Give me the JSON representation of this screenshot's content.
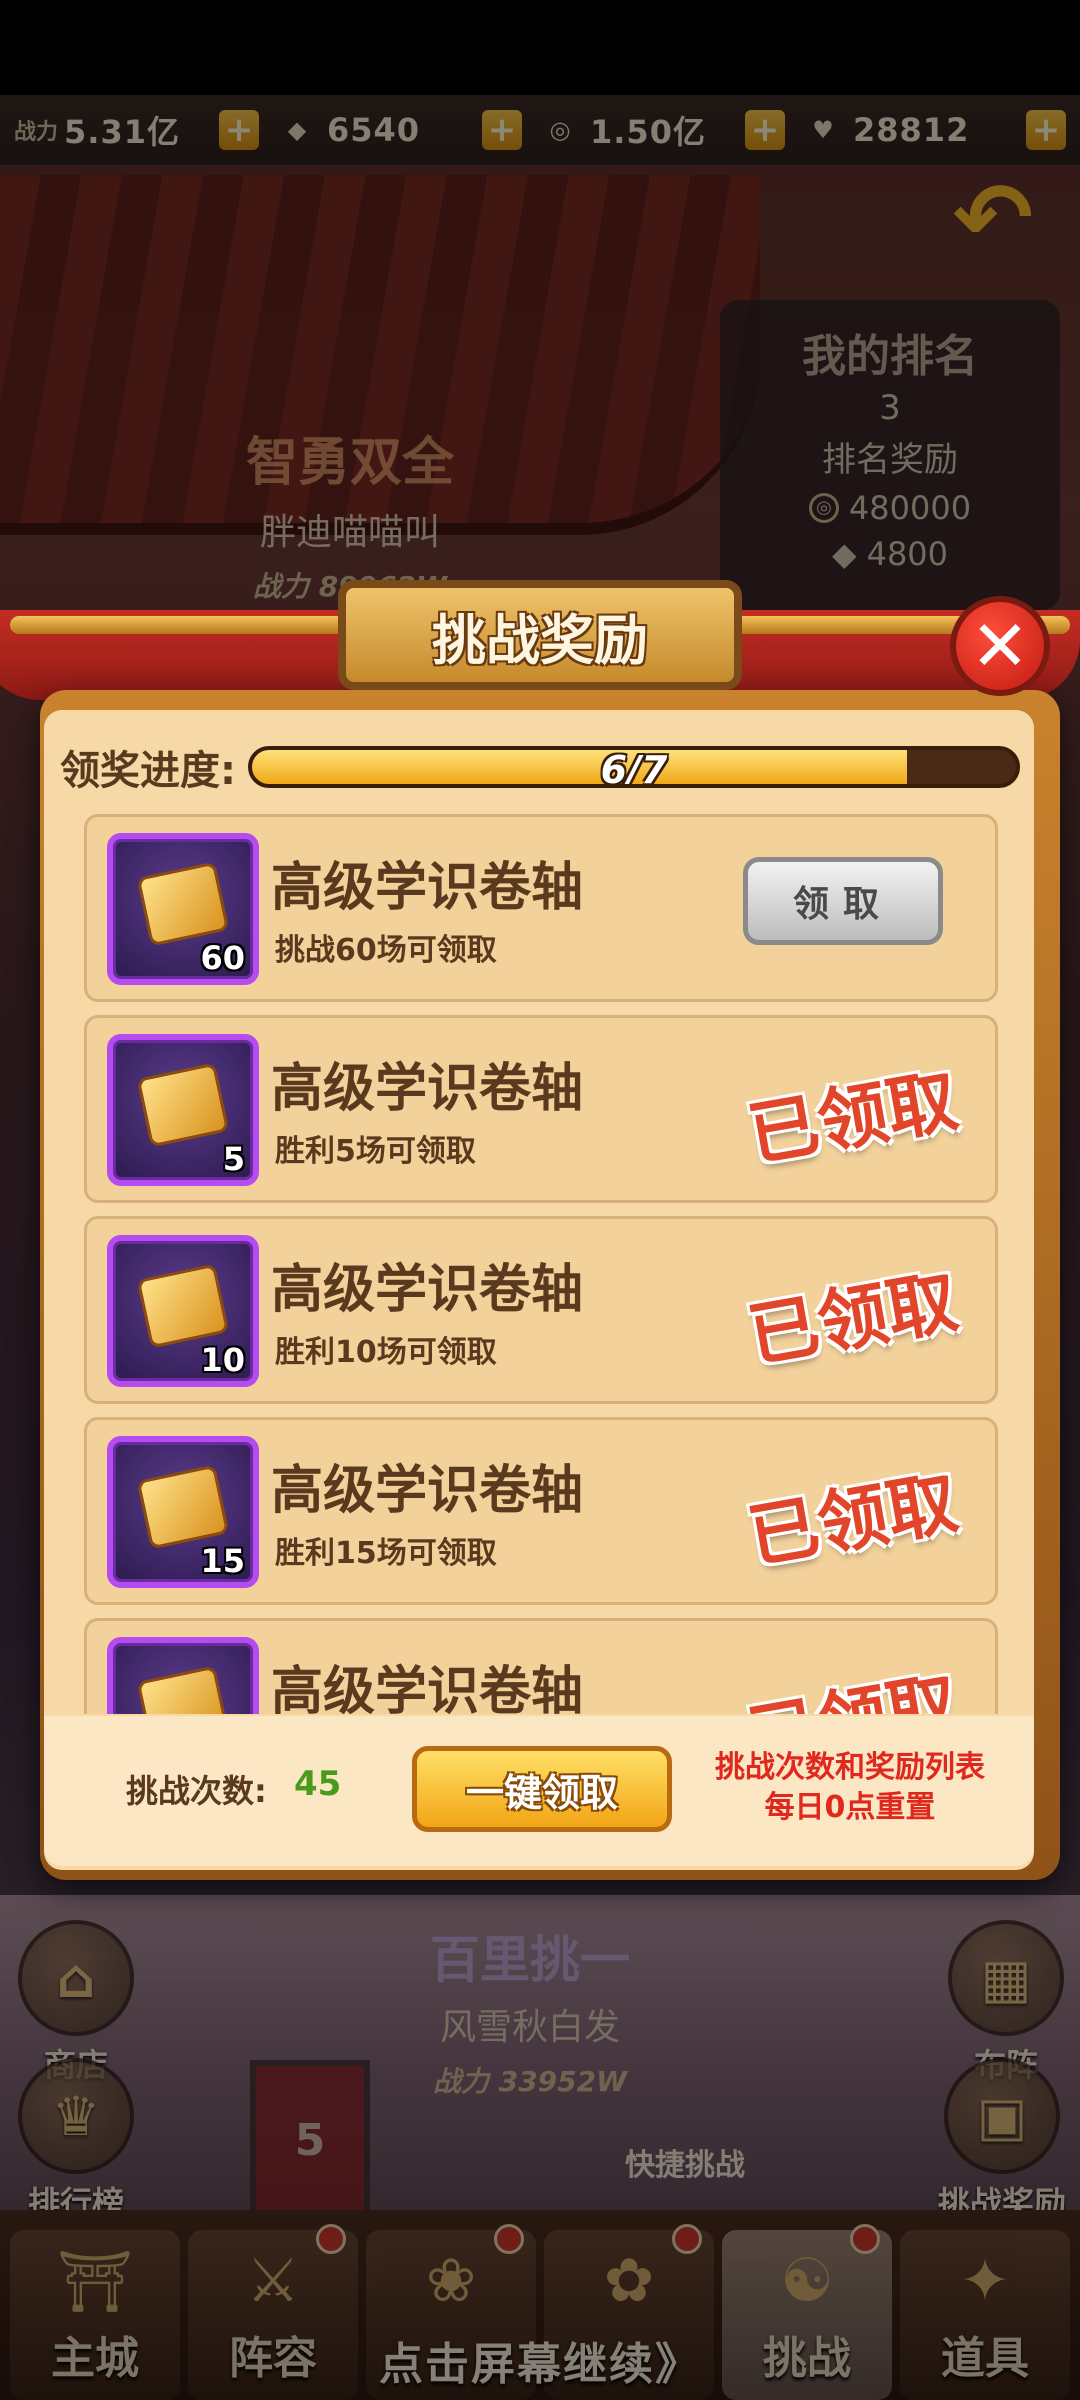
{
  "topbar": {
    "power_label": "战力",
    "power_value": "5.31亿",
    "gems_value": "6540",
    "coins_value": "1.50亿",
    "hearts_value": "28812"
  },
  "rank_panel": {
    "title": "我的排名",
    "rank": "3",
    "reward_title": "排名奖励",
    "reward_coins": "480000",
    "reward_gems": "4800"
  },
  "player_top": {
    "title": "智勇双全",
    "name": "胖迪喵喵叫",
    "power": "战力 89962W"
  },
  "player_bottom": {
    "title": "百里挑一",
    "name": "风雪秋白发",
    "power": "战力 33952W"
  },
  "side": {
    "shop": "商店",
    "ranking": "排行榜",
    "formation": "布阵",
    "challenge_reward": "挑战奖励",
    "quick_challenge": "快捷挑战",
    "flag_number": "5"
  },
  "modal": {
    "title": "挑战奖励",
    "progress_label": "领奖进度:",
    "progress_text": "6/7",
    "progress_fraction": 0.857,
    "items": [
      {
        "name": "高级学识卷轴",
        "qty": "60",
        "condition": "挑战60场可领取",
        "state": "claim",
        "button": "领取"
      },
      {
        "name": "高级学识卷轴",
        "qty": "5",
        "condition": "胜利5场可领取",
        "state": "claimed",
        "stamp": "已领取"
      },
      {
        "name": "高级学识卷轴",
        "qty": "10",
        "condition": "胜利10场可领取",
        "state": "claimed",
        "stamp": "已领取"
      },
      {
        "name": "高级学识卷轴",
        "qty": "15",
        "condition": "胜利15场可领取",
        "state": "claimed",
        "stamp": "已领取"
      },
      {
        "name": "高级学识卷轴",
        "qty": "",
        "condition": "",
        "state": "claimed",
        "stamp": "已领取"
      }
    ],
    "count_label": "挑战次数:",
    "count_value": "45",
    "one_key_label": "一键领取",
    "reset_note_1": "挑战次数和奖励列表",
    "reset_note_2": "每日0点重置"
  },
  "bottom_nav": [
    {
      "label": "主城",
      "icon": "castle-icon",
      "dot": false
    },
    {
      "label": "阵容",
      "icon": "lineup-icon",
      "dot": true
    },
    {
      "label": "",
      "icon": "gift-icon",
      "dot": true
    },
    {
      "label": "",
      "icon": "bag-icon",
      "dot": true
    },
    {
      "label": "挑战",
      "icon": "challenge-icon",
      "dot": true
    },
    {
      "label": "道具",
      "icon": "items-icon",
      "dot": false
    }
  ],
  "continue_text": "点击屏幕继续》"
}
